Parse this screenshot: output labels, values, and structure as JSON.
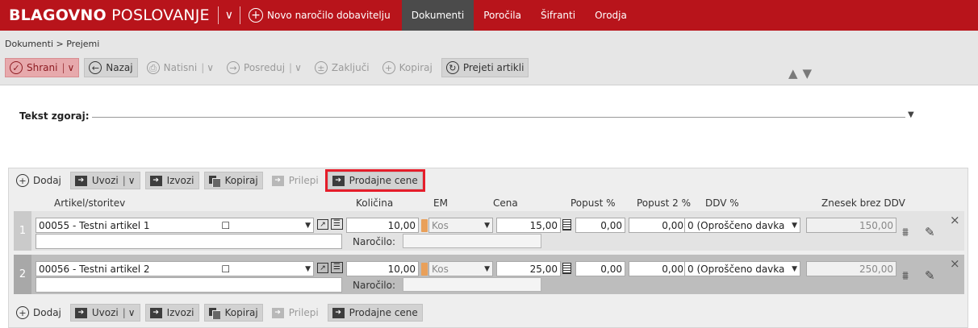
{
  "topbar": {
    "brand_bold": "BLAGOVNO",
    "brand_rest": "POSLOVANJE",
    "new_order": "Novo naročilo dobavitelju",
    "tabs": [
      "Dokumenti",
      "Poročila",
      "Šifranti",
      "Orodja"
    ],
    "active_tab": "Dokumenti",
    "bg_color": "#b8141b"
  },
  "breadcrumb": "Dokumenti > Prejemi",
  "toolbar": {
    "save": "Shrani",
    "back": "Nazaj",
    "print": "Natisni",
    "forward": "Posreduj",
    "lock": "Zaključi",
    "copy": "Kopiraj",
    "received": "Prejeti artikli"
  },
  "text_top": {
    "label": "Tekst zgoraj:"
  },
  "items_toolbar": {
    "add": "Dodaj",
    "import": "Uvozi",
    "export": "Izvozi",
    "copy": "Kopiraj",
    "paste": "Prilepi",
    "sale_prices": "Prodajne cene"
  },
  "columns": [
    "Artikel/storitev",
    "Količina",
    "EM",
    "Cena",
    "Popust %",
    "Popust 2 %",
    "DDV %",
    "Znesek brez DDV"
  ],
  "rows": [
    {
      "num": "1",
      "article": "00055 - Testni artikel 1",
      "qty": "10,00",
      "unit": "Kos",
      "price": "15,00",
      "disc": "0,00",
      "disc2": "0,00",
      "vat": "0 (Oproščeno davka",
      "amount": "150,00",
      "order_label": "Naročilo:"
    },
    {
      "num": "2",
      "article": "00056 - Testni artikel 2",
      "qty": "10,00",
      "unit": "Kos",
      "price": "25,00",
      "disc": "0,00",
      "disc2": "0,00",
      "vat": "0 (Oproščeno davka",
      "amount": "250,00",
      "order_label": "Naročilo:"
    }
  ]
}
